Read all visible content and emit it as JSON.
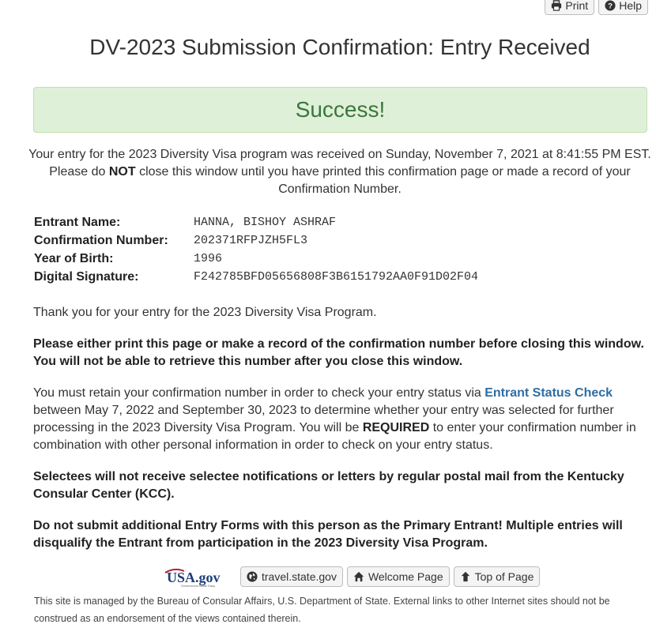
{
  "toolbar": {
    "print_label": "Print",
    "help_label": "Help"
  },
  "page_title": "DV-2023 Submission Confirmation: Entry Received",
  "success_banner": "Success!",
  "intro": {
    "line1": "Your entry for the 2023 Diversity Visa program was received on Sunday, November 7, 2021 at 8:41:55 PM EST.",
    "line2_a": "Please do ",
    "line2_b": "NOT",
    "line2_c": " close this window until you have printed this confirmation page or made a record of your",
    "line3": "Confirmation Number."
  },
  "details": [
    {
      "label": "Entrant Name:",
      "value": "HANNA, BISHOY ASHRAF"
    },
    {
      "label": "Confirmation Number:",
      "value": "202371RFPJZH5FL3"
    },
    {
      "label": "Year of Birth:",
      "value": "1996"
    },
    {
      "label": "Digital Signature:",
      "value": "F242785BFD05656808F3B6151792AA0F91D02F04"
    }
  ],
  "thanks": "Thank you for your entry for the 2023 Diversity Visa Program.",
  "warning_print": "Please either print this page or make a record of the confirmation number before closing this window. You will not be able to retrieve this number after you close this window.",
  "retain": {
    "a": "You must retain your confirmation number in order to check your entry status via ",
    "link": "Entrant Status Check",
    "b": " between May 7, 2022 and September 30, 2023 to determine whether your entry was selected for further processing in the 2023 Diversity Visa Program. You will be ",
    "required": "REQUIRED",
    "c": " to enter your confirmation number in combination with other personal information in order to check on your entry status."
  },
  "selectees": "Selectees will not receive selectee notifications or letters by regular postal mail from the Kentucky Consular Center (KCC).",
  "no_additional": "Do not submit additional Entry Forms with this person as the Primary Entrant! Multiple entries will disqualify the Entrant from participation in the 2023 Diversity Visa Program.",
  "footer": {
    "logo_text": "USA.gov",
    "logo_tagline": "Government Made Easy",
    "travel_label": "travel.state.gov",
    "welcome_label": "Welcome Page",
    "top_label": "Top of Page",
    "disclaimer": "This site is managed by the Bureau of Consular Affairs, U.S. Department of State. External links to other Internet sites should not be construed as an endorsement of the views contained therein."
  },
  "colors": {
    "success_bg": "#dff0d8",
    "success_text": "#3c763d",
    "link": "#2e6da4"
  }
}
